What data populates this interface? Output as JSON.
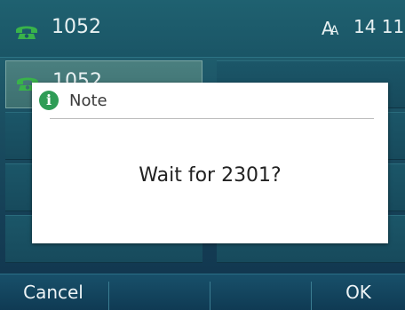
{
  "status_bar": {
    "account": "1052",
    "font_icon": "A",
    "font_icon_small": "A",
    "time": "14 11"
  },
  "line_keys": {
    "left": [
      {
        "label": "1052",
        "icon": "phone-icon",
        "active": true
      },
      {
        "label": "",
        "active": false
      },
      {
        "label": "",
        "active": false
      },
      {
        "label": "",
        "active": false
      }
    ],
    "right": [
      {
        "label": ""
      },
      {
        "label": ""
      },
      {
        "label": ""
      },
      {
        "label": ""
      }
    ]
  },
  "dialog": {
    "title": "Note",
    "icon": "info-icon",
    "message": "Wait for 2301?"
  },
  "softkeys": {
    "cancel": "Cancel",
    "key2": "",
    "key3": "",
    "ok": "OK"
  },
  "colors": {
    "accent_green": "#2f9c56",
    "background": "#174f60"
  }
}
